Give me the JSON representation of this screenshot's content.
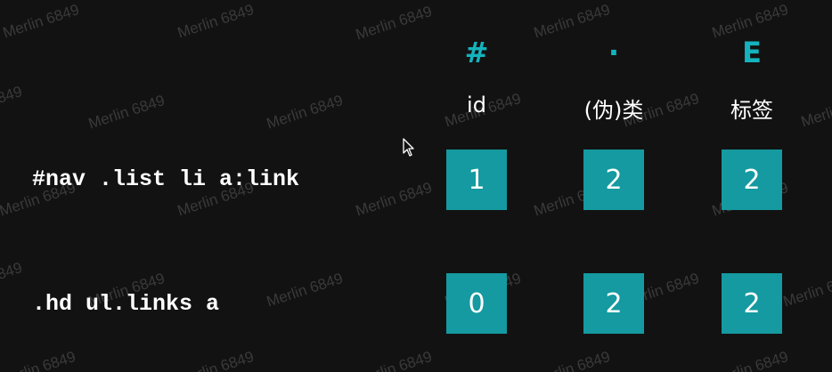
{
  "watermark": "Merlin 6849",
  "columns": [
    {
      "symbol": "#",
      "label": "id"
    },
    {
      "symbol": "·",
      "label": "(伪)类"
    },
    {
      "symbol": "E",
      "label": "标签"
    }
  ],
  "rows": [
    {
      "selector": "#nav .list li a:link",
      "values": [
        "1",
        "2",
        "2"
      ]
    },
    {
      "selector": ".hd ul.links a",
      "values": [
        "0",
        "2",
        "2"
      ]
    }
  ],
  "colors": {
    "background": "#121212",
    "accent": "#14b3bd",
    "box": "#149aa0"
  },
  "icons": {
    "cursor": "mouse-pointer-icon"
  }
}
